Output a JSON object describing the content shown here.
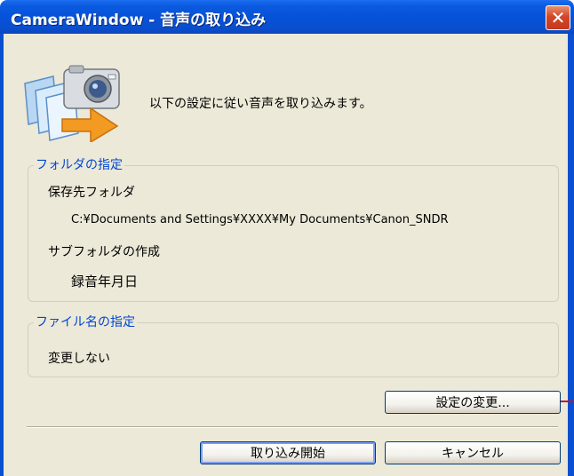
{
  "window": {
    "title": "CameraWindow - 音声の取り込み",
    "close_glyph": "✕"
  },
  "header": {
    "icon": "camera-transfer-icon",
    "message": "以下の設定に従い音声を取り込みます。"
  },
  "folder_group": {
    "legend": "フォルダの指定",
    "save_folder_label": "保存先フォルダ",
    "save_folder_path": "C:¥Documents and Settings¥XXXX¥My Documents¥Canon_SNDR",
    "subfolder_label": "サブフォルダの作成",
    "subfolder_value": "録音年月日"
  },
  "filename_group": {
    "legend": "ファイル名の指定",
    "value": "変更しない"
  },
  "buttons": {
    "change_settings": "設定の変更...",
    "start_import": "取り込み開始",
    "cancel": "キャンセル"
  },
  "colors": {
    "titlebar": "#0a55d8",
    "dialog_bg": "#ece9d8",
    "legend_text": "#0046d5",
    "close_button": "#d3462a",
    "callout_line": "#c8102e"
  }
}
